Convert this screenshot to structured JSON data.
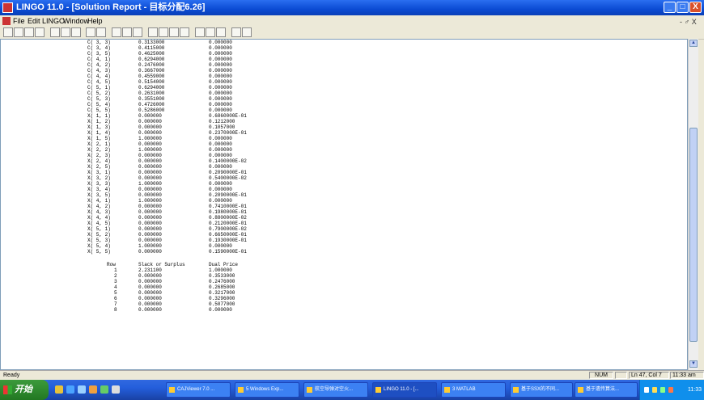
{
  "window": {
    "title": "LINGO 11.0 - [Solution Report - 目标分配6.26]",
    "minimize": "_",
    "maximize": "□",
    "close": "X"
  },
  "menu": {
    "items": [
      "File",
      "Edit",
      "LINGO",
      "Window",
      "Help"
    ],
    "mdi_controls": "- ♂ X"
  },
  "report": {
    "top_rows": [
      {
        "name": "C( 3, 3)",
        "value": "0.3133000",
        "cost": "0.000000"
      },
      {
        "name": "C( 3, 4)",
        "value": "0.4115000",
        "cost": "0.000000"
      },
      {
        "name": "C( 3, 5)",
        "value": "0.4625000",
        "cost": "0.000000"
      },
      {
        "name": "C( 4, 1)",
        "value": "0.6294000",
        "cost": "0.000000"
      },
      {
        "name": "C( 4, 2)",
        "value": "0.2476000",
        "cost": "0.000000"
      },
      {
        "name": "C( 4, 3)",
        "value": "0.3667000",
        "cost": "0.000000"
      },
      {
        "name": "C( 4, 4)",
        "value": "0.4559000",
        "cost": "0.000000"
      },
      {
        "name": "C( 4, 5)",
        "value": "0.5154000",
        "cost": "0.000000"
      },
      {
        "name": "C( 5, 1)",
        "value": "0.6294000",
        "cost": "0.000000"
      },
      {
        "name": "C( 5, 2)",
        "value": "0.2631000",
        "cost": "0.000000"
      },
      {
        "name": "C( 5, 3)",
        "value": "0.3551000",
        "cost": "0.000000"
      },
      {
        "name": "C( 5, 4)",
        "value": "0.4726000",
        "cost": "0.000000"
      },
      {
        "name": "C( 5, 5)",
        "value": "0.5286000",
        "cost": "0.000000"
      },
      {
        "name": "X( 1, 1)",
        "value": "0.000000",
        "cost": "0.6860000E-01"
      },
      {
        "name": "X( 1, 2)",
        "value": "0.000000",
        "cost": "0.1212000"
      },
      {
        "name": "X( 1, 3)",
        "value": "0.000000",
        "cost": "0.1057000"
      },
      {
        "name": "X( 1, 4)",
        "value": "0.000000",
        "cost": "0.2370000E-01"
      },
      {
        "name": "X( 1, 5)",
        "value": "1.000000",
        "cost": "0.000000"
      },
      {
        "name": "X( 2, 1)",
        "value": "0.000000",
        "cost": "0.000000"
      },
      {
        "name": "X( 2, 2)",
        "value": "1.000000",
        "cost": "0.000000"
      },
      {
        "name": "X( 2, 3)",
        "value": "0.000000",
        "cost": "0.000000"
      },
      {
        "name": "X( 2, 4)",
        "value": "0.000000",
        "cost": "0.1400000E-02"
      },
      {
        "name": "X( 2, 5)",
        "value": "0.000000",
        "cost": "0.000000"
      },
      {
        "name": "X( 3, 1)",
        "value": "0.000000",
        "cost": "0.2090000E-01"
      },
      {
        "name": "X( 3, 2)",
        "value": "0.000000",
        "cost": "0.5400000E-02"
      },
      {
        "name": "X( 3, 3)",
        "value": "1.000000",
        "cost": "0.000000"
      },
      {
        "name": "X( 3, 4)",
        "value": "0.000000",
        "cost": "0.000000"
      },
      {
        "name": "X( 3, 5)",
        "value": "0.000000",
        "cost": "0.2090000E-01"
      },
      {
        "name": "X( 4, 1)",
        "value": "1.000000",
        "cost": "0.000000"
      },
      {
        "name": "X( 4, 2)",
        "value": "0.000000",
        "cost": "0.7410000E-01"
      },
      {
        "name": "X( 4, 3)",
        "value": "0.000000",
        "cost": "0.1980000E-01"
      },
      {
        "name": "X( 4, 4)",
        "value": "0.000000",
        "cost": "0.8800000E-02"
      },
      {
        "name": "X( 4, 5)",
        "value": "0.000000",
        "cost": "0.2120000E-01"
      },
      {
        "name": "X( 5, 1)",
        "value": "0.000000",
        "cost": "0.7900000E-02"
      },
      {
        "name": "X( 5, 2)",
        "value": "0.000000",
        "cost": "0.6650000E-01"
      },
      {
        "name": "X( 5, 3)",
        "value": "0.000000",
        "cost": "0.1930000E-01"
      },
      {
        "name": "X( 5, 4)",
        "value": "1.000000",
        "cost": "0.000000"
      },
      {
        "name": "X( 5, 5)",
        "value": "0.000000",
        "cost": "0.1590000E-01"
      }
    ],
    "row_headers": {
      "row": "Row",
      "slack": "Slack or Surplus",
      "dual": "Dual Price"
    },
    "bottom_rows": [
      {
        "row": "1",
        "slack": "2.231100",
        "dual": "1.000000"
      },
      {
        "row": "2",
        "slack": "0.000000",
        "dual": "0.3533000"
      },
      {
        "row": "3",
        "slack": "0.000000",
        "dual": "0.2476000"
      },
      {
        "row": "4",
        "slack": "0.000000",
        "dual": "0.2685000"
      },
      {
        "row": "5",
        "slack": "0.000000",
        "dual": "0.3217000"
      },
      {
        "row": "6",
        "slack": "0.000000",
        "dual": "0.3296000"
      },
      {
        "row": "7",
        "slack": "0.000000",
        "dual": "0.5077000"
      },
      {
        "row": "8",
        "slack": "0.000000",
        "dual": "0.000000"
      }
    ]
  },
  "status": {
    "ready": "Ready",
    "mode": "NUM",
    "position": "Ln 47, Col 7",
    "time": "11:33 am"
  },
  "taskbar": {
    "start": "开始",
    "tasks": [
      "CAJViewer 7.0 ...",
      "5 Windows Exp...",
      "航空导弹对空火...",
      "LINGO 11.0 - [...",
      "3 MATLAB",
      "基于SSX的不同...",
      "基于遗传算法..."
    ],
    "clock": "11:33"
  }
}
